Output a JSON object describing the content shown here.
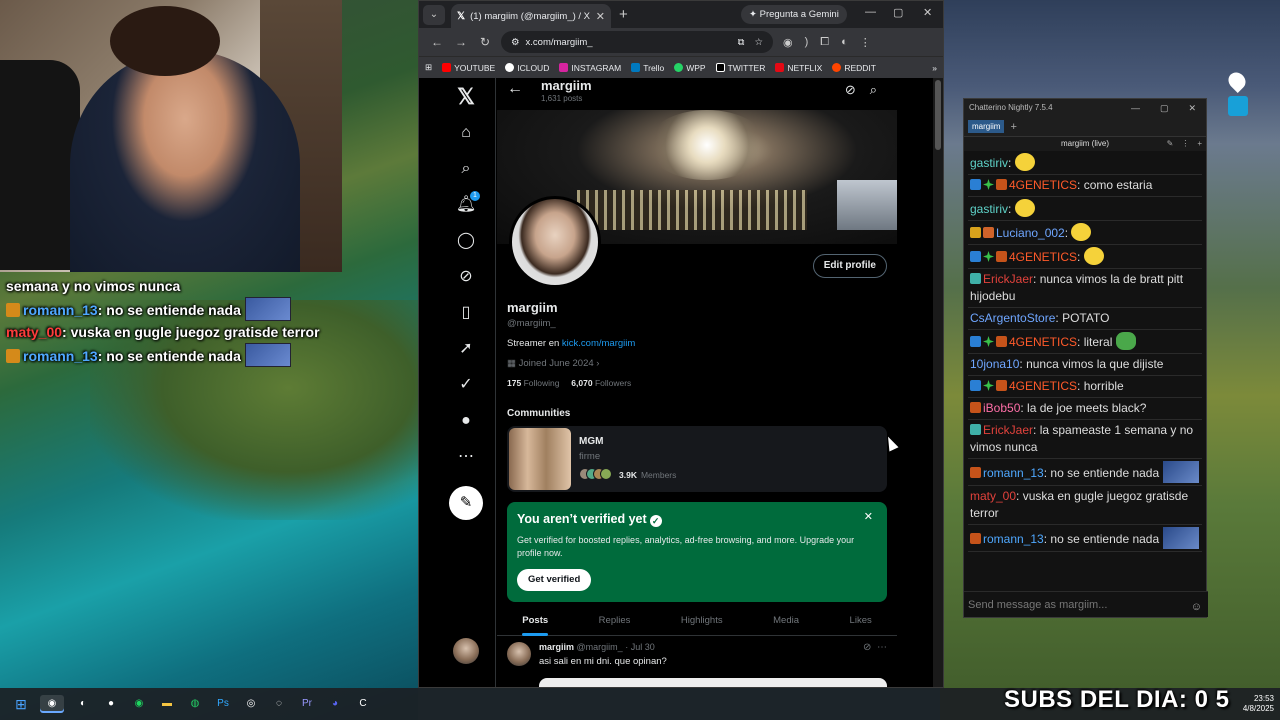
{
  "overlay_chat": [
    {
      "text": "semana y no vimos nunca"
    },
    {
      "user": "romann_13",
      "msg": "no se entiende nada",
      "color": "#4fa8ff"
    },
    {
      "user": "maty_00",
      "msg": "vuska en gugle juegoz gratisde terror",
      "color": "#ff3c3c"
    },
    {
      "user": "romann_13",
      "msg": "no se entiende nada",
      "color": "#4fa8ff"
    }
  ],
  "browser": {
    "tab_title": "(1) margiim (@margiim_) / X",
    "gemini_label": "Pregunta a Gemini",
    "url": "x.com/margiim_",
    "bookmarks": [
      "YOUTUBE",
      "ICLOUD",
      "INSTAGRAM",
      "Trello",
      "WPP",
      "TWITTER",
      "NETFLIX",
      "REDDIT"
    ]
  },
  "x_sidebar": {
    "icons": [
      "x-logo-icon",
      "home-icon",
      "search-icon",
      "notifications-icon",
      "messages-icon",
      "grok-icon",
      "bookmarks-icon",
      "rocket-icon",
      "verified-icon",
      "profile-icon",
      "more-icon"
    ],
    "notif_count": "1"
  },
  "profile": {
    "header_name": "margiim",
    "header_posts": "1,631 posts",
    "edit_label": "Edit profile",
    "name": "margiim",
    "handle": "@margiim_",
    "bio_prefix": "Streamer en",
    "bio_link": "kick.com/margiim",
    "joined": "Joined June 2024",
    "following_count": "175",
    "following_label": "Following",
    "followers_count": "6,070",
    "followers_label": "Followers"
  },
  "communities": {
    "title": "Communities",
    "name": "MGM",
    "desc": "firme",
    "members_count": "3.9K",
    "members_label": "Members"
  },
  "verify": {
    "title": "You aren’t verified yet",
    "body": "Get verified for boosted replies, analytics, ad-free browsing, and more. Upgrade your profile now.",
    "button": "Get verified"
  },
  "tabs": [
    "Posts",
    "Replies",
    "Highlights",
    "Media",
    "Likes"
  ],
  "tweet": {
    "name": "margiim",
    "handle": "@margiim_",
    "date": "· Jul 30",
    "text": "asi sali en mi dni. que opinan?"
  },
  "chatterino": {
    "title": "Chatterino Nightly 7.5.4",
    "tab": "margiim",
    "split_title": "margiim (live)",
    "messages": [
      {
        "user": "gastiriv",
        "msg": "",
        "color": "#5fd3c9",
        "badges": [],
        "emote": "emo"
      },
      {
        "user": "4GENETICS",
        "msg": "como estaria",
        "color": "#ff5a2a",
        "badges": [
          "cb-blue",
          "cb-green",
          "cb-orange"
        ]
      },
      {
        "user": "gastiriv",
        "msg": "",
        "color": "#5fd3c9",
        "badges": [],
        "emote": "emo"
      },
      {
        "user": "Luciano_002",
        "msg": "",
        "color": "#6fa6ff",
        "badges": [
          "cb-gold",
          "cb-box"
        ],
        "emote": "emo"
      },
      {
        "user": "4GENETICS",
        "msg": "",
        "color": "#ff5a2a",
        "badges": [
          "cb-blue",
          "cb-green",
          "cb-orange"
        ],
        "emote": "emo"
      },
      {
        "user": "ErickJaer",
        "msg": "nunca vimos la de bratt pitt hijodebu",
        "color": "#e2423c",
        "badges": [
          "cb-teal"
        ]
      },
      {
        "user": "CsArgentoStore",
        "msg": "POTATO",
        "color": "#6fa6ff",
        "badges": []
      },
      {
        "user": "4GENETICS",
        "msg": "literal",
        "color": "#ff5a2a",
        "badges": [
          "cb-blue",
          "cb-green",
          "cb-orange"
        ],
        "emote": "emo-frog"
      },
      {
        "user": "10jona10",
        "msg": "nunca vimos la que dijiste",
        "color": "#6fa6ff",
        "badges": []
      },
      {
        "user": "4GENETICS",
        "msg": "horrible",
        "color": "#ff5a2a",
        "badges": [
          "cb-blue",
          "cb-green",
          "cb-orange"
        ]
      },
      {
        "user": "iBob50",
        "msg": "la de joe meets black?",
        "color": "#ff6fa8",
        "badges": [
          "cb-orange"
        ]
      },
      {
        "user": "ErickJaer",
        "msg": "la spameaste 1 semana y no vimos nunca",
        "color": "#e2423c",
        "badges": [
          "cb-teal"
        ]
      },
      {
        "user": "romann_13",
        "msg": "no se entiende nada",
        "color": "#4fa8ff",
        "badges": [
          "cb-orange"
        ],
        "emote": "emo-pic"
      },
      {
        "user": "maty_00",
        "msg": "vuska en gugle juegoz gratisde terror",
        "color": "#e2423c",
        "badges": []
      },
      {
        "user": "romann_13",
        "msg": "no se entiende nada",
        "color": "#4fa8ff",
        "badges": [
          "cb-orange"
        ],
        "emote": "emo-pic"
      }
    ],
    "input_placeholder": "Send message as margiim..."
  },
  "subs_banner": "SUBS DEL DIA: 0 5",
  "clock": {
    "time": "23:53",
    "date": "4/8/2025"
  }
}
